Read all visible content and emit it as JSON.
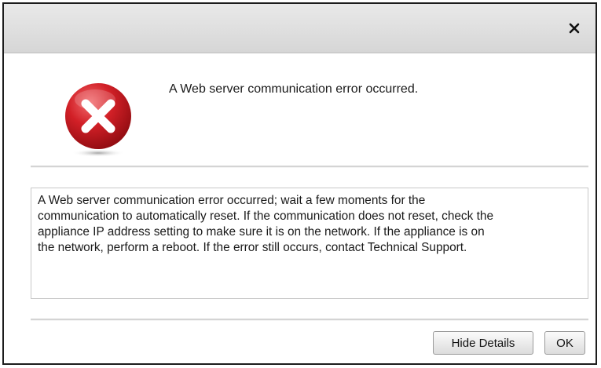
{
  "dialog": {
    "close_icon": "close-icon",
    "error_icon": "error-x-icon",
    "message": "A Web server communication error occurred.",
    "details": "A Web server communication error occurred; wait a few moments for the\ncommunication to automatically reset. If the communication does not reset, check the\nappliance IP address setting to make sure it is on the network. If the appliance is on\nthe network, perform a reboot. If the error still occurs, contact Technical Support.",
    "buttons": {
      "hide_details": "Hide Details",
      "ok": "OK"
    },
    "colors": {
      "error_red": "#c8161d",
      "titlebar": "#dcdcdc"
    }
  }
}
